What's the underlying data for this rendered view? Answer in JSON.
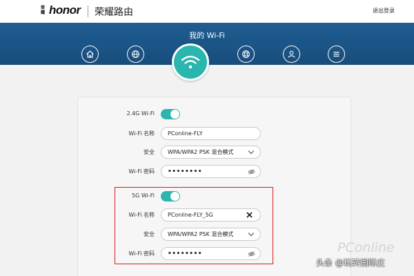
{
  "header": {
    "brand_small": "荣耀",
    "brand_logo": "honor",
    "title": "荣耀路由",
    "logout_label": "退出登录"
  },
  "banner": {
    "title": "我的 Wi-Fi",
    "nav_icons": [
      "home-icon",
      "globe-icon",
      "wifi-icon",
      "internet-globe-icon",
      "user-icon",
      "menu-icon"
    ]
  },
  "wifi24": {
    "toggle_label": "2.4G Wi-Fi",
    "enabled": true,
    "name_label": "Wi-Fi 名称",
    "name_value": "PConline-FLY",
    "security_label": "安全",
    "security_value": "WPA/WPA2 PSK 混合模式",
    "password_label": "Wi-Fi 密码",
    "password_value": "••••••••"
  },
  "wifi5": {
    "toggle_label": "5G Wi-Fi",
    "enabled": true,
    "name_label": "Wi-Fi 名称",
    "name_value": "PConline-FLY_5G",
    "security_label": "安全",
    "security_value": "WPA/WPA2 PSK 混合模式",
    "password_label": "Wi-Fi 密码",
    "password_value": "••••••••"
  },
  "watermarks": {
    "pconline": "PConline",
    "source": "头条 @玩转国际庄"
  },
  "colors": {
    "banner": "#1f5d92",
    "accent": "#2ab5ae",
    "highlight": "#d71d1d"
  }
}
